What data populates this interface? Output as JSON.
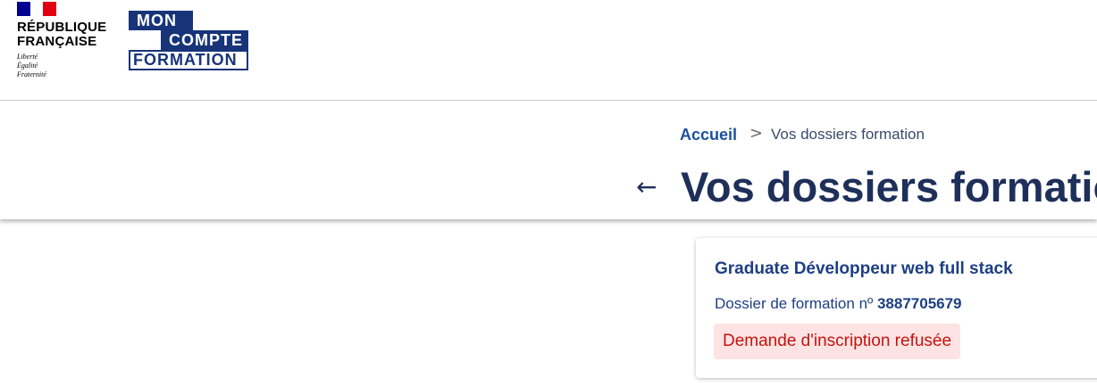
{
  "header": {
    "rf_line1": "RÉPUBLIQUE",
    "rf_line2": "FRANÇAISE",
    "rf_motto_1": "Liberté",
    "rf_motto_2": "Égalité",
    "rf_motto_3": "Fraternité",
    "mcf_line1": "MON",
    "mcf_line2": "COMPTE",
    "mcf_line3": "FORMATION"
  },
  "breadcrumb": {
    "home": "Accueil",
    "separator": ">",
    "current": "Vos dossiers formation"
  },
  "page": {
    "back_icon": "←",
    "title": "Vos dossiers formation"
  },
  "card": {
    "title": "Graduate Développeur web full stack",
    "dossier_label": "Dossier de formation nº",
    "dossier_number": "3887705679",
    "status": "Demande d'inscription refusée"
  },
  "colors": {
    "primary": "#1d3f83",
    "status_bg": "#fde3e3",
    "status_text": "#c4140f",
    "flag_blue": "#000091",
    "flag_red": "#e1000f"
  }
}
